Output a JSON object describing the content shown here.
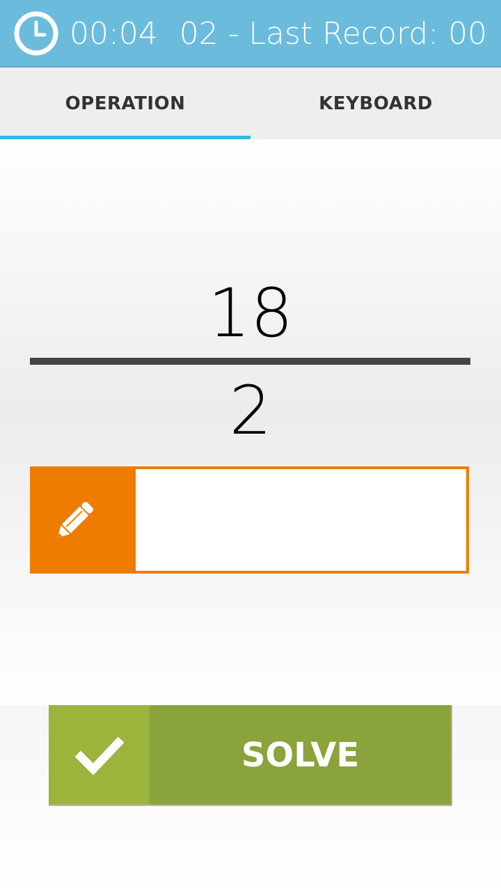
{
  "header": {
    "timer": "00:04",
    "record_text": "02 - Last Record: 00",
    "icon": "clock-icon",
    "background_color": "#6bbcdc"
  },
  "tabs": [
    {
      "label": "OPERATION",
      "selected": true
    },
    {
      "label": "KEYBOARD",
      "selected": false
    }
  ],
  "accent_color": "#33b5e5",
  "problem": {
    "numerator": "18",
    "denominator": "2"
  },
  "answer": {
    "value": "",
    "icon": "pencil-icon",
    "accent_color": "#ee7c00"
  },
  "solve_button": {
    "label": "SOLVE",
    "icon": "check-icon",
    "color": "#8aa33a"
  }
}
